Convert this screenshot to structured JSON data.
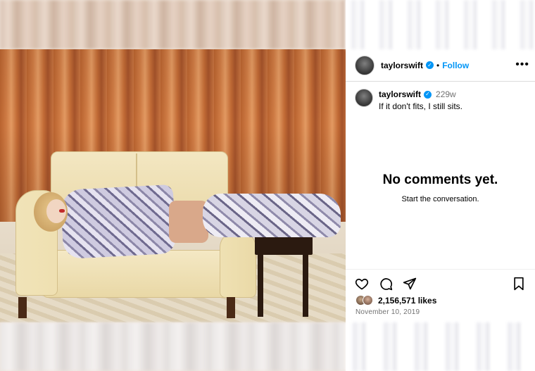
{
  "post": {
    "username": "taylorswift",
    "verified_glyph": "✓",
    "separator": "•",
    "follow_label": "Follow",
    "more_label": "•••",
    "caption": {
      "username": "taylorswift",
      "age": "229w",
      "text": "If it don't fits, I still sits."
    },
    "empty_comments": {
      "title": "No comments yet.",
      "subtitle": "Start the conversation."
    },
    "likes_count": "2,156,571 likes",
    "date": "November 10, 2019"
  },
  "icons": {
    "like": "heart-icon",
    "comment": "comment-icon",
    "share": "share-icon",
    "save": "bookmark-icon",
    "more": "more-options-icon",
    "verified": "verified-badge-icon"
  },
  "colors": {
    "accent": "#0095f6",
    "muted": "#737373",
    "divider": "#dbdbdb"
  }
}
